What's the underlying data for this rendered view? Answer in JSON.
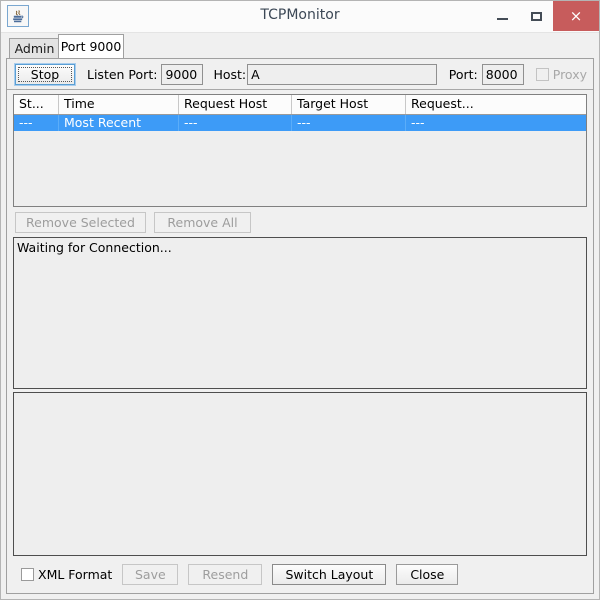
{
  "window": {
    "title": "TCPMonitor",
    "app_icon": "java-coffee-cup-icon",
    "controls": {
      "minimize": "minimize-icon",
      "maximize": "maximize-icon",
      "close": "×"
    },
    "close_button_color": "#c75c5c"
  },
  "tabs": [
    {
      "label": "Admin",
      "active": false
    },
    {
      "label": "Port 9000",
      "active": true
    }
  ],
  "toolbar": {
    "stop_button": "Stop",
    "listen_port_label": "Listen Port:",
    "listen_port_value": "9000",
    "host_label": "Host:",
    "host_value": "A",
    "port_label": "Port:",
    "port_value": "8000",
    "proxy_label": "Proxy",
    "proxy_checked": false
  },
  "table": {
    "columns": [
      "St...",
      "Time",
      "Request Host",
      "Target Host",
      "Request..."
    ],
    "rows": [
      {
        "cells": [
          "---",
          "Most Recent",
          "---",
          "---",
          "---"
        ],
        "selected": true
      }
    ],
    "selection_color": "#3d9bf7"
  },
  "actions": {
    "remove_selected": "Remove Selected",
    "remove_all": "Remove All"
  },
  "panes": {
    "top_text": "Waiting for Connection...",
    "bottom_text": ""
  },
  "bottombar": {
    "xml_format_label": "XML Format",
    "xml_format_checked": false,
    "save": "Save",
    "resend": "Resend",
    "switch_layout": "Switch Layout",
    "close": "Close"
  }
}
